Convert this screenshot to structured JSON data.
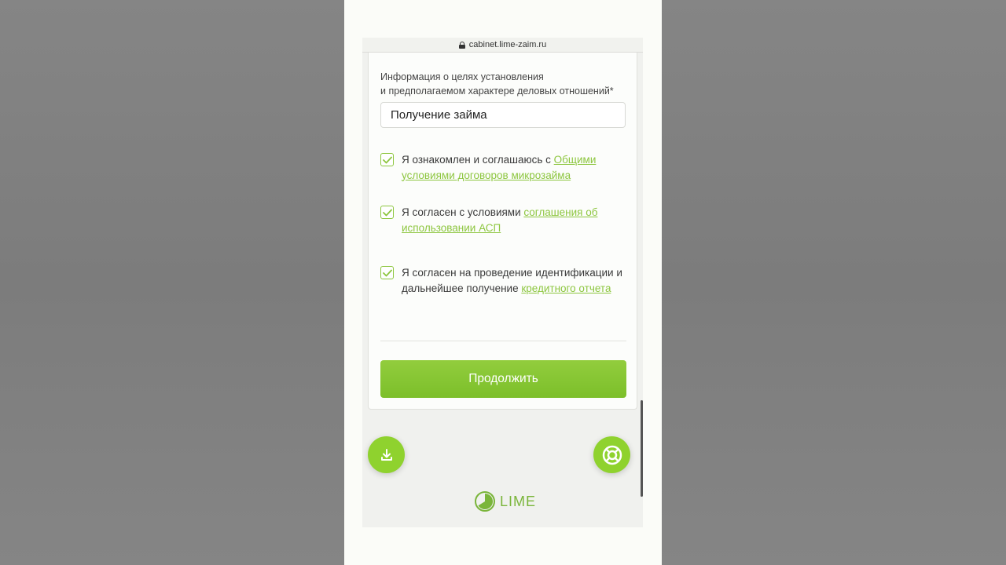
{
  "browser": {
    "url": "cabinet.lime-zaim.ru"
  },
  "form": {
    "field_label_line1": "Информация о целях установления",
    "field_label_line2": "и предполагаемом характере деловых отношений*",
    "field_value": "Получение займа",
    "checkboxes": [
      {
        "checked": true,
        "text": "Я ознакомлен и соглашаюсь с ",
        "link": "Общими условиями договоров микрозайма"
      },
      {
        "checked": true,
        "text": "Я согласен с условиями ",
        "link": "соглашения об использовании АСП"
      },
      {
        "checked": true,
        "text": "Я согласен на проведение идентификации и дальнейшее получение ",
        "link": "кредитного отчета"
      }
    ],
    "continue_label": "Продолжить"
  },
  "fabs": {
    "download_icon": "download-icon",
    "help_icon": "lifebuoy-icon"
  },
  "brand": {
    "name": "LIME",
    "accent": "#8dc63f"
  }
}
